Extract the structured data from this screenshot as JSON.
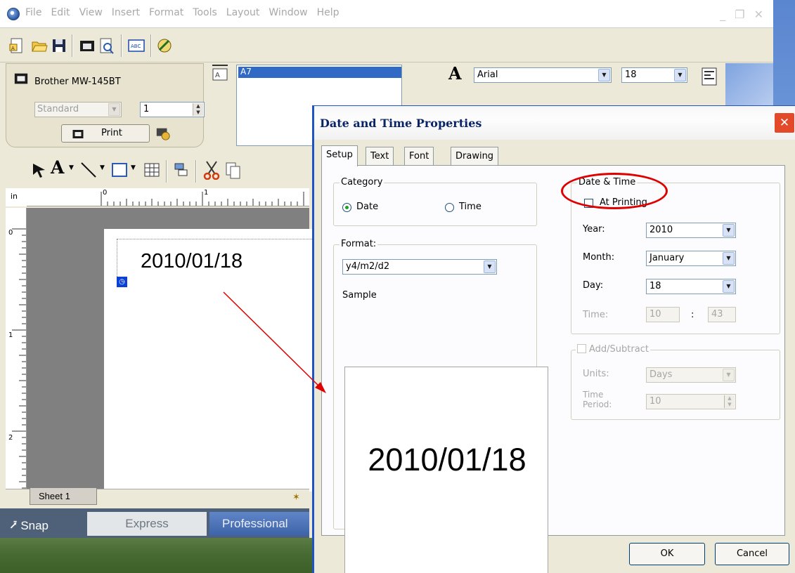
{
  "menubar": {
    "items": [
      "File",
      "Edit",
      "View",
      "Insert",
      "Format",
      "Tools",
      "Layout",
      "Window",
      "Help"
    ]
  },
  "printer": {
    "name": "Brother MW-145BT",
    "paper_mode": "Standard",
    "copies": "1",
    "print_label": "Print"
  },
  "object_list": {
    "selected": "A7"
  },
  "font_panel": {
    "font": "Arial",
    "size": "18"
  },
  "ruler": {
    "unit": "in",
    "h_marks": [
      "0",
      "1"
    ],
    "v_marks": [
      "0",
      "1",
      "2"
    ]
  },
  "canvas": {
    "label_text": "2010/01/18"
  },
  "sheets": {
    "tab": "Sheet 1"
  },
  "modes": {
    "snap": "Snap",
    "express": "Express",
    "professional": "Professional"
  },
  "dialog": {
    "title": "Date and Time Properties",
    "close": "✕",
    "tabs": [
      "Setup",
      "Text",
      "Font",
      "Drawing"
    ],
    "category": {
      "label": "Category",
      "date": "Date",
      "time": "Time",
      "selected": "Date"
    },
    "format": {
      "label": "Format:",
      "value": "y4/m2/d2",
      "sample_label": "Sample",
      "sample_text": "2010/01/18"
    },
    "datetime": {
      "label": "Date & Time",
      "at_printing": "At Printing",
      "at_printing_checked": false,
      "year_label": "Year:",
      "year": "2010",
      "month_label": "Month:",
      "month": "January",
      "day_label": "Day:",
      "day": "18",
      "time_label": "Time:",
      "hour": "10",
      "time_sep": ":",
      "minute": "43"
    },
    "add_subtract": {
      "label": "Add/Subtract",
      "checked": false,
      "units_label": "Units:",
      "units": "Days",
      "period_label_1": "Time",
      "period_label_2": "Period:",
      "period": "10"
    },
    "ok": "OK",
    "cancel": "Cancel"
  },
  "colors": {
    "selection": "#316ac5",
    "annotation": "#e00000",
    "title_text": "#0a246a",
    "close_button": "#e24a2a"
  }
}
